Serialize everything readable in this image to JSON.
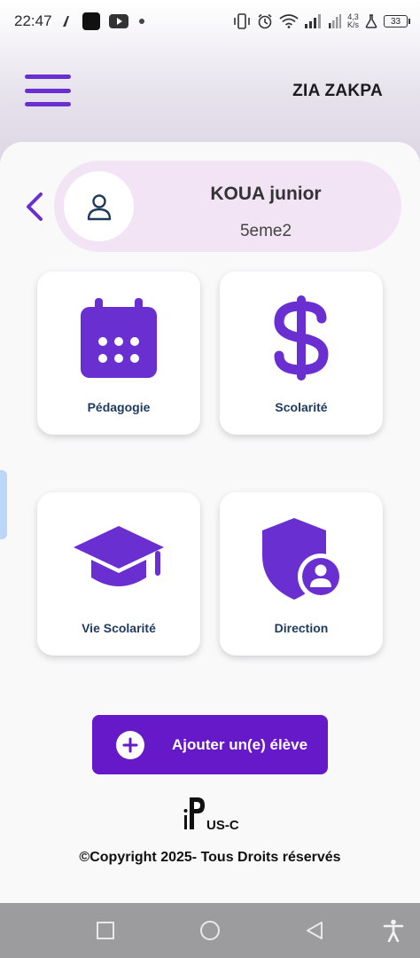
{
  "status_bar": {
    "time": "22:47",
    "network_speed_value": "4,3",
    "network_speed_unit": "K/s",
    "battery_level": "33",
    "icons": [
      "activity-icon",
      "app-icon",
      "youtube-icon",
      "dot-icon",
      "vibrate-icon",
      "alarm-icon",
      "wifi-icon",
      "signal-icon",
      "signal-icon-2",
      "lab-icon",
      "battery-icon"
    ]
  },
  "header": {
    "user_name": "ZIA ZAKPA",
    "menu_icon": "hamburger-menu-icon"
  },
  "student": {
    "name": "KOUA junior",
    "class": "5eme2",
    "avatar_icon": "user-outline-icon"
  },
  "tiles": [
    {
      "label": "Pédagogie",
      "icon": "calendar-icon"
    },
    {
      "label": "Scolarité",
      "icon": "dollar-icon"
    },
    {
      "label": "Vie Scolarité",
      "icon": "graduation-cap-icon"
    },
    {
      "label": "Direction",
      "icon": "shield-user-icon"
    }
  ],
  "add_student": {
    "label": "Ajouter un(e) élève",
    "icon": "plus-circle-icon"
  },
  "brand": {
    "logo_text": "iPLUS-CI"
  },
  "footer": {
    "copyright": "©Copyright 2025- Tous Droits réservés"
  },
  "nav": {
    "icons": [
      "recent-apps-icon",
      "home-icon",
      "back-triangle-icon",
      "accessibility-icon"
    ]
  },
  "colors": {
    "accent": "#6619c9",
    "icon_purple": "#6a2fd0",
    "card_pink": "#f2e4f5",
    "label_navy": "#1e3a5f"
  }
}
